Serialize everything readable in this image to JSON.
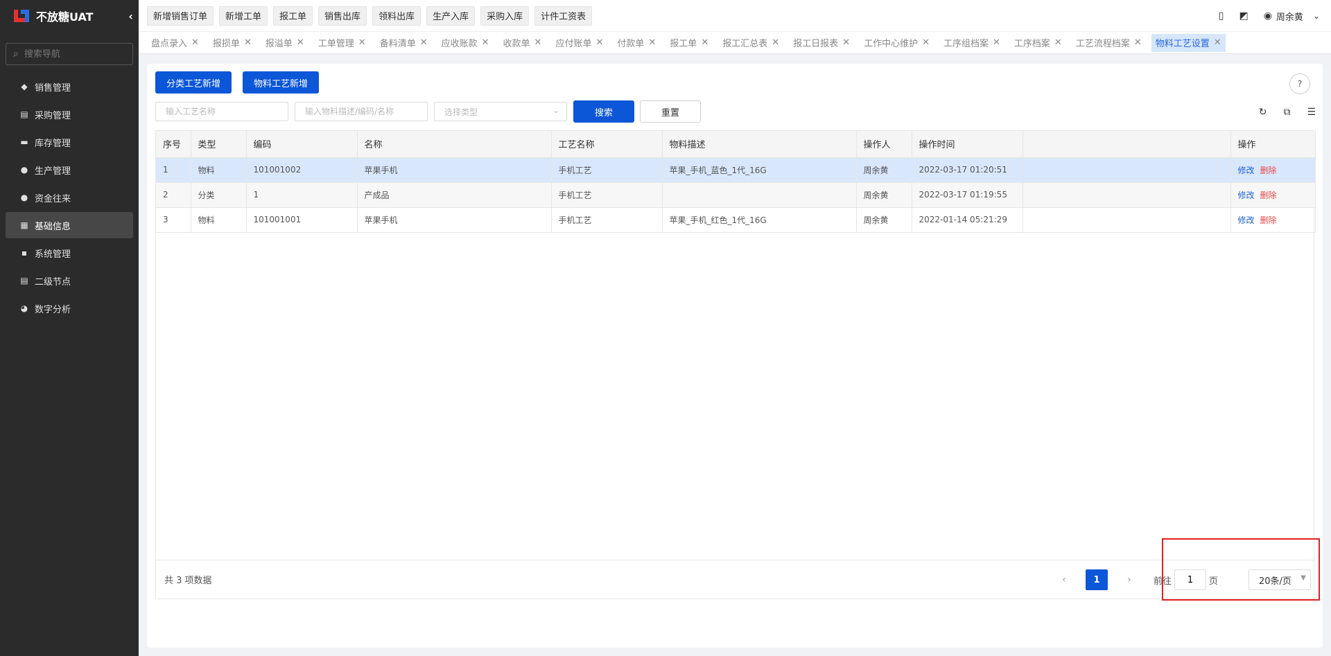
{
  "brand": {
    "name": "不放糖UAT",
    "collapse_icon": "chevron-left-icon"
  },
  "sidebar": {
    "search_placeholder": "搜索导航",
    "items": [
      {
        "label": "销售管理",
        "icon": "tag-icon",
        "glyph": "◆"
      },
      {
        "label": "采购管理",
        "icon": "cart-icon",
        "glyph": "▤"
      },
      {
        "label": "库存管理",
        "icon": "box-icon",
        "glyph": "▬"
      },
      {
        "label": "生产管理",
        "icon": "cluster-icon",
        "glyph": "●"
      },
      {
        "label": "资金往来",
        "icon": "money-icon",
        "glyph": "●"
      },
      {
        "label": "基础信息",
        "icon": "grid-icon",
        "glyph": "▦"
      },
      {
        "label": "系统管理",
        "icon": "apps-icon",
        "glyph": "▪"
      },
      {
        "label": "二级节点",
        "icon": "doc-icon",
        "glyph": "▤"
      },
      {
        "label": "数字分析",
        "icon": "pie-icon",
        "glyph": "◕"
      }
    ],
    "active_index": 5
  },
  "topbar": {
    "quick_actions": [
      "新增销售订单",
      "新增工单",
      "报工单",
      "销售出库",
      "领料出库",
      "生产入库",
      "采购入库",
      "计件工资表"
    ],
    "user_name": "周余黄"
  },
  "tabs": {
    "items": [
      "盘点录入",
      "报损单",
      "报溢单",
      "工单管理",
      "备料清单",
      "应收账款",
      "收款单",
      "应付账单",
      "付款单",
      "报工单",
      "报工汇总表",
      "报工日报表",
      "工作中心维护",
      "工序组档案",
      "工序档案",
      "工艺流程档案",
      "物料工艺设置"
    ],
    "active_index": 16
  },
  "toolbar": {
    "add_category_label": "分类工艺新增",
    "add_material_label": "物料工艺新增",
    "process_name_placeholder": "输入工艺名称",
    "material_placeholder": "输入物料描述/编码/名称",
    "type_placeholder": "选择类型",
    "search_label": "搜索",
    "reset_label": "重置"
  },
  "table": {
    "columns": [
      "序号",
      "类型",
      "编码",
      "名称",
      "工艺名称",
      "物料描述",
      "操作人",
      "操作时间",
      "",
      "操作"
    ],
    "rows": [
      {
        "no": "1",
        "type": "物料",
        "code": "101001002",
        "name": "苹果手机",
        "process": "手机工艺",
        "desc": "苹果_手机_蓝色_1代_16G",
        "operator": "周余黄",
        "time": "2022-03-17 01:20:51"
      },
      {
        "no": "2",
        "type": "分类",
        "code": "1",
        "name": "产成品",
        "process": "手机工艺",
        "desc": "",
        "operator": "周余黄",
        "time": "2022-03-17 01:19:55"
      },
      {
        "no": "3",
        "type": "物料",
        "code": "101001001",
        "name": "苹果手机",
        "process": "手机工艺",
        "desc": "苹果_手机_红色_1代_16G",
        "operator": "周余黄",
        "time": "2022-01-14 05:21:29"
      }
    ],
    "edit_label": "修改",
    "delete_label": "删除"
  },
  "pagination": {
    "total_text": "共 3 项数据",
    "current_page": "1",
    "goto_label": "前往",
    "goto_value": "1",
    "page_unit": "页",
    "page_size": "20条/页"
  },
  "colors": {
    "primary": "#0c56d8",
    "sidebar_bg": "#2b2b2b",
    "delete": "#e84a4a",
    "highlight": "#e41f1f"
  }
}
